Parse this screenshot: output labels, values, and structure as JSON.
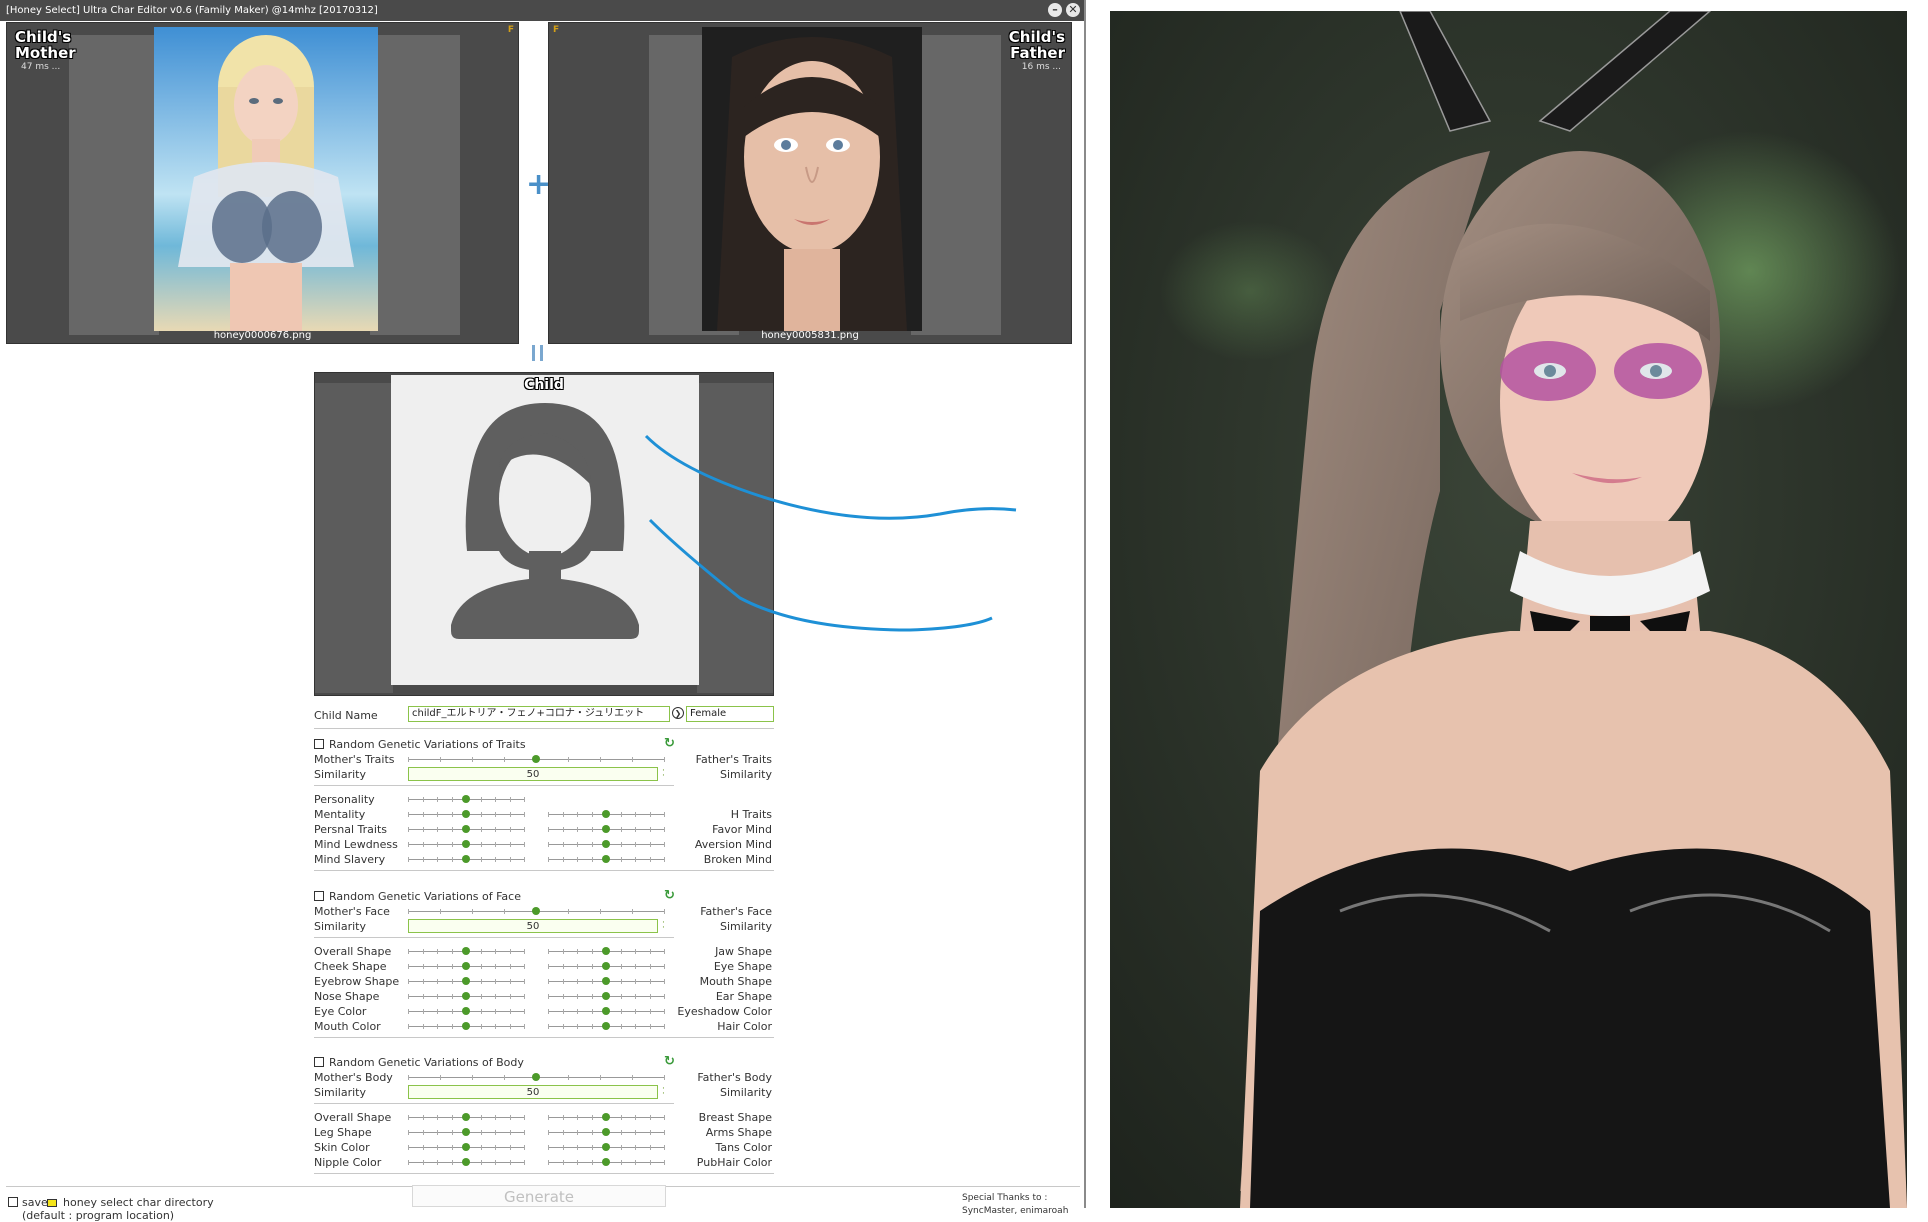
{
  "window": {
    "title": "[Honey Select] Ultra Char Editor v0.6 (Family Maker) @14mhz [20170312]",
    "minimize_glyph": "–",
    "close_glyph": "✕"
  },
  "mother_panel": {
    "label_line1": "Child's",
    "label_line2": "Mother",
    "timing": "47 ms ...",
    "filename": "honey0000676.png",
    "flag": "F"
  },
  "father_panel": {
    "label_line1": "Child's",
    "label_line2": "Father",
    "timing": "16 ms ...",
    "filename": "honey0005831.png",
    "flag": "F"
  },
  "operator_plus": "+",
  "child_panel": {
    "label": "Child"
  },
  "child_name": {
    "label": "Child Name",
    "value": "childF_エルトリア・フェノ+コロナ・ジュリエット",
    "gender": "Female"
  },
  "traits": {
    "checkbox_label": "Random Genetic Variations of Traits",
    "mother_label": "Mother's Traits",
    "father_label": "Father's Traits",
    "similarity_left": "Similarity",
    "similarity_right": "Similarity",
    "similarity_value": "50",
    "left_rows": [
      "Personality",
      "Mentality",
      "Persnal Traits",
      "Mind Lewdness",
      "Mind Slavery"
    ],
    "right_rows": [
      "H Traits",
      "Favor Mind",
      "Aversion Mind",
      "Broken Mind"
    ]
  },
  "face": {
    "checkbox_label": "Random Genetic Variations of Face",
    "mother_label": "Mother's Face",
    "father_label": "Father's Face",
    "similarity_left": "Similarity",
    "similarity_right": "Similarity",
    "similarity_value": "50",
    "left_rows": [
      "Overall Shape",
      "Cheek Shape",
      "Eyebrow Shape",
      "Nose Shape",
      "Eye Color",
      "Mouth Color"
    ],
    "right_rows": [
      "Jaw Shape",
      "Eye Shape",
      "Mouth Shape",
      "Ear Shape",
      "Eyeshadow Color",
      "Hair Color"
    ]
  },
  "body": {
    "checkbox_label": "Random Genetic Variations of Body",
    "mother_label": "Mother's Body",
    "father_label": "Father's Body",
    "similarity_left": "Similarity",
    "similarity_right": "Similarity",
    "similarity_value": "50",
    "left_rows": [
      "Overall Shape",
      "Leg Shape",
      "Skin Color",
      "Nipple Color"
    ],
    "right_rows": [
      "Breast Shape",
      "Arms Shape",
      "Tans Color",
      "PubHair Color"
    ]
  },
  "footer": {
    "save_label": "save",
    "directory_label": "honey select char directory",
    "default_label": "(default : program location)",
    "generate_label": "Generate",
    "thanks_line1": "Special Thanks to :",
    "thanks_line2": "SyncMaster, enimaroah"
  },
  "colors": {
    "accent_green": "#4c9a2a",
    "annotation_blue": "#1e90d6",
    "panel_gray": "#4a4a4a"
  }
}
